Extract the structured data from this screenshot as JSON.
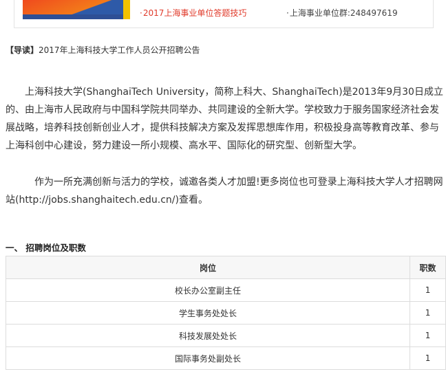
{
  "top_strip": {
    "promo_link": "2017上海事业单位答题技巧",
    "group_label": "上海事业单位群:248497619"
  },
  "lead": {
    "tag": "【导读】",
    "text": "2017年上海科技大学工作人员公开招聘公告"
  },
  "paragraphs": [
    "上海科技大学(ShanghaiTech University，简称上科大、ShanghaiTech)是2013年9月30日成立的、由上海市人民政府与中国科学院共同举办、共同建设的全新大学。学校致力于服务国家经济社会发展战略，培养科技创新创业人才，提供科技解决方案及发挥思想库作用，积极投身高等教育改革、参与上海科创中心建设，努力建设一所小规模、高水平、国际化的研究型、创新型大学。",
    "作为一所充满创新与活力的学校，诚邀各类人才加盟!更多岗位也可登录上海科技大学人才招聘网站(http://jobs.shanghaitech.edu.cn/)查看。"
  ],
  "section": {
    "title": "一、 招聘岗位及职数"
  },
  "table": {
    "headers": [
      "岗位",
      "职数"
    ],
    "rows": [
      [
        "校长办公室副主任",
        "1"
      ],
      [
        "学生事务处处长",
        "1"
      ],
      [
        "科技发展处处长",
        "1"
      ],
      [
        "国际事务处副处长",
        "1"
      ]
    ]
  },
  "colors": {
    "promo_link": "#e03a2a",
    "banner_orange": "#f04a1e",
    "banner_blue": "#2e5aa8"
  }
}
